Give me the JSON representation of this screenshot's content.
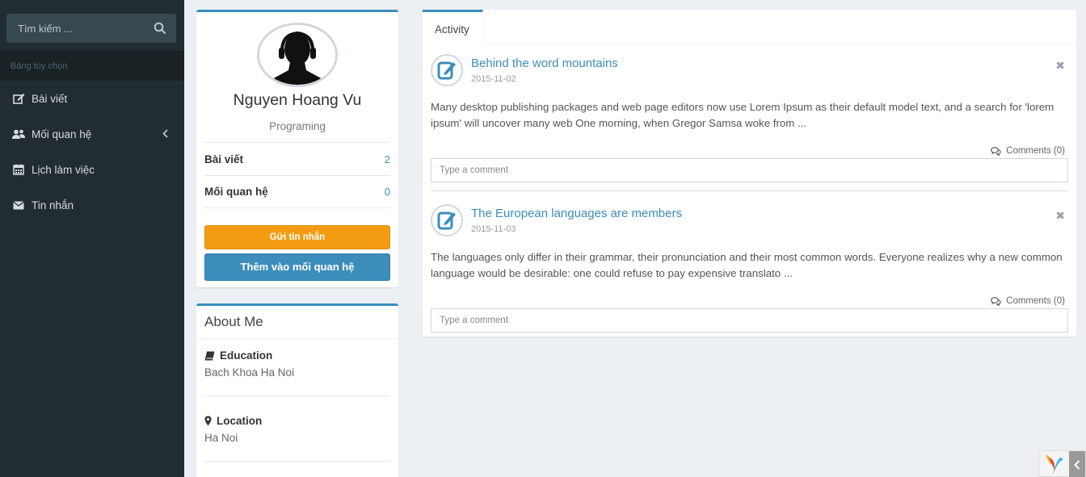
{
  "sidebar": {
    "search": {
      "placeholder": "Tìm kiếm ..."
    },
    "header": "Bảng tùy chọn",
    "items": [
      {
        "label": "Bài viết",
        "icon": "edit-icon"
      },
      {
        "label": "Mối quan hệ",
        "icon": "users-icon",
        "has_submenu": true
      },
      {
        "label": "Lịch làm việc",
        "icon": "calendar-icon"
      },
      {
        "label": "Tin nhắn",
        "icon": "envelope-icon"
      }
    ]
  },
  "profile": {
    "name": "Nguyen Hoang Vu",
    "role": "Programing",
    "stats": [
      {
        "label": "Bài viết",
        "value": "2"
      },
      {
        "label": "Mối quan hệ",
        "value": "0"
      }
    ],
    "send_message_label": "Gửi tin nhắn",
    "add_relation_label": "Thêm vào mối quan hệ"
  },
  "about": {
    "title": "About Me",
    "education": {
      "label": "Education",
      "value": "Bach Khoa Ha Noi"
    },
    "location": {
      "label": "Location",
      "value": "Ha Noi"
    }
  },
  "activity": {
    "tab_label": "Activity",
    "posts": [
      {
        "title": "Behind the word mountains",
        "date": "2015-11-02",
        "text": "Many desktop publishing packages and web page editors now use Lorem Ipsum as their default model text, and a search for 'lorem ipsum' will uncover many web One morning, when Gregor Samsa woke from ...",
        "comments_label": "Comments (0)",
        "comment_placeholder": "Type a comment"
      },
      {
        "title": "The European languages are members",
        "date": "2015-11-03",
        "text": "The languages only differ in their grammar, their pronunciation and their most common words. Everyone realizes why a new common language would be desirable: one could refuse to pay expensive translato ...",
        "comments_label": "Comments (0)",
        "comment_placeholder": "Type a comment"
      }
    ]
  },
  "colors": {
    "sidebar_bg": "#222d32",
    "accent_blue": "#3c8dbc",
    "warning_orange": "#f39c12",
    "page_bg": "#ecf0f5"
  }
}
